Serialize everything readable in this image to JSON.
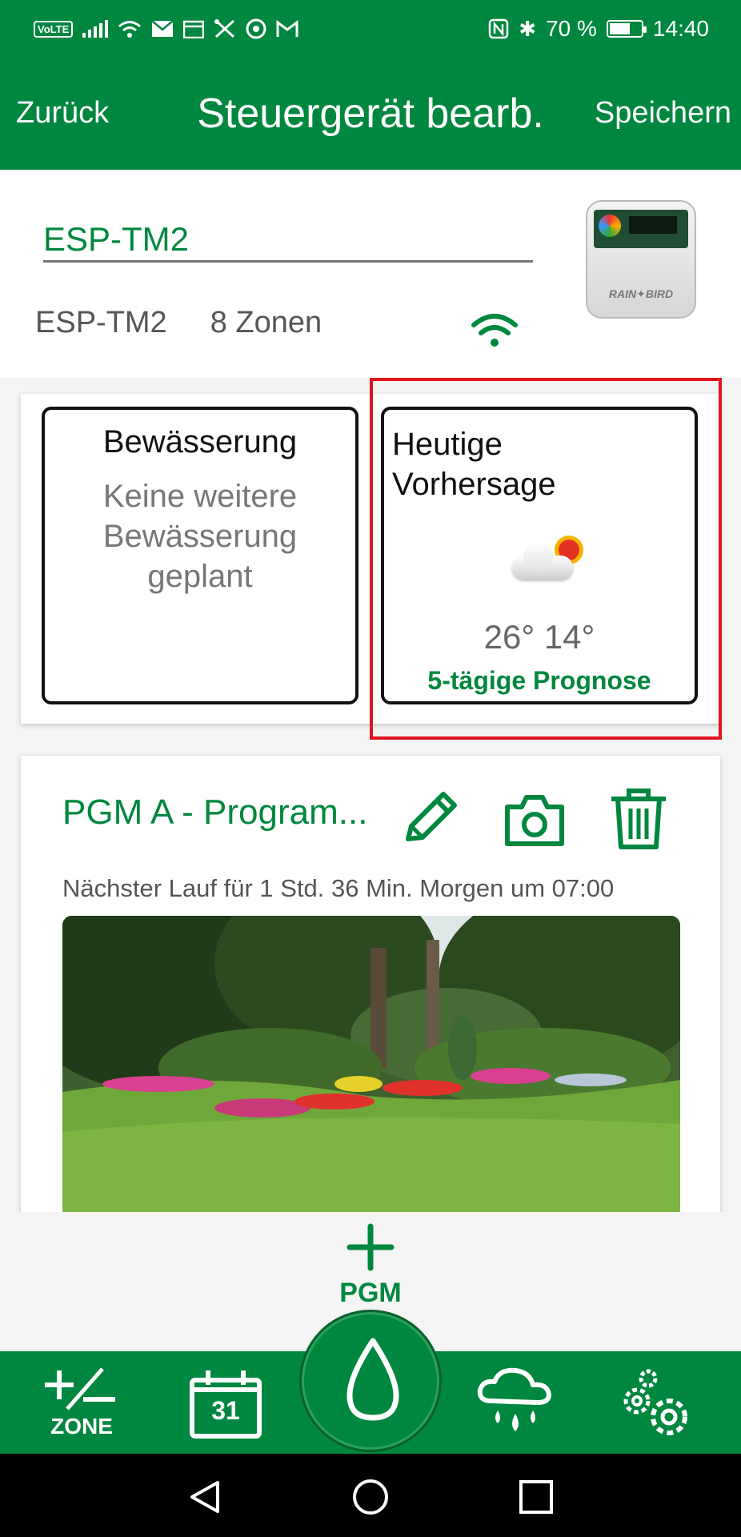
{
  "status_bar": {
    "volte": "VoLTE",
    "battery_text": "70 %",
    "battery_level": 0.7,
    "time": "14:40"
  },
  "header": {
    "back_label": "Zurück",
    "title": "Steuergerät bearb.",
    "save_label": "Speichern"
  },
  "controller": {
    "name_value": "ESP-TM2",
    "model": "ESP-TM2",
    "zones": "8 Zonen",
    "device_brand": "RAIN✦BIRD"
  },
  "irrigation_card": {
    "title": "Bewässerung",
    "status_lines": [
      "Keine weitere",
      "Bewässerung",
      "geplant"
    ]
  },
  "forecast_card": {
    "title_lines": [
      "Heutige",
      "Vorhersage"
    ],
    "temps": "26° 14°",
    "link": "5-tägige Prognose"
  },
  "program": {
    "title": "PGM A - Program...",
    "next_run": "Nächster Lauf für 1 Std. 36 Min. Morgen um 07:00"
  },
  "add_program": {
    "label": "PGM"
  },
  "bottom_nav": {
    "zone_label": "ZONE",
    "calendar_day": "31"
  },
  "colors": {
    "brand_green": "#00873f",
    "highlight_red": "#e0141e"
  }
}
